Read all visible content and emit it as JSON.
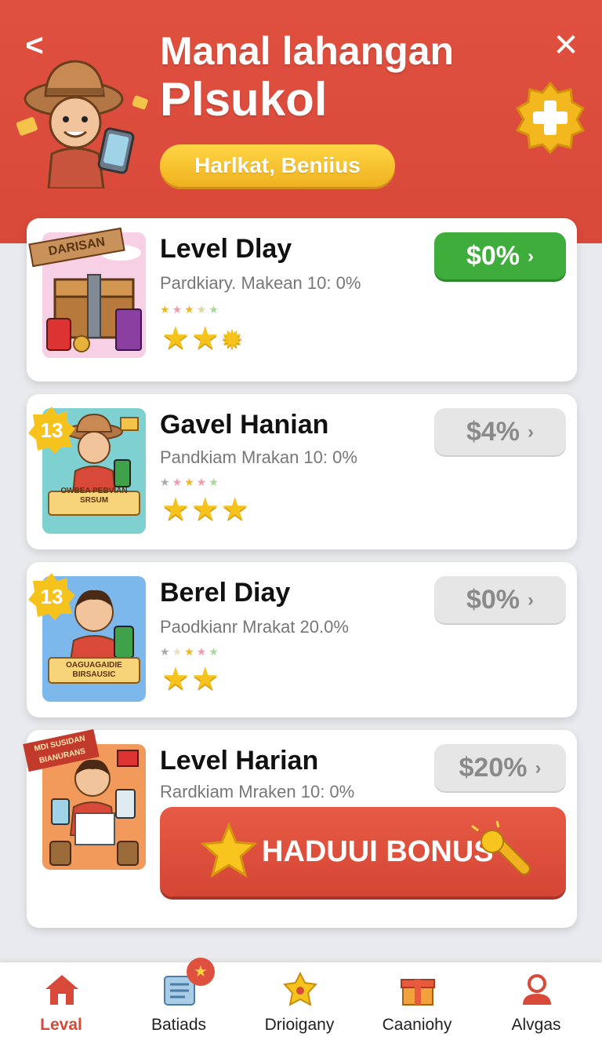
{
  "header": {
    "title_line1": "Manal lahangan",
    "title_line2": "Plsukol",
    "subtitle": "Harlkat, Beniius",
    "back_glyph": "<",
    "close_glyph": "✕",
    "colors": {
      "header_bg": "#d9493a",
      "pill": "#f0b21e"
    }
  },
  "cards": [
    {
      "title": "Level Dlay",
      "subtitle": "Pardkiary. Makean 10: 0%",
      "thumb_label": "DARISAN",
      "value_label": "$0%",
      "value_style": "green",
      "rating_stars": 3
    },
    {
      "title": "Gavel Hanian",
      "subtitle": "Pandkiam Mrakan 10: 0%",
      "thumb_label": "OWBEA PEBVIAN SRSUM",
      "thumb_badge": "13",
      "value_label": "$4%",
      "value_style": "gray",
      "rating_stars": 3
    },
    {
      "title": "Berel Diay",
      "subtitle": "Paodkianr Mrakat 20.0%",
      "thumb_label": "OAGUAGAIDIE BIRSAUSIC",
      "thumb_badge": "13",
      "value_label": "$0%",
      "value_style": "gray",
      "rating_stars": 2
    },
    {
      "title": "Level Harian",
      "subtitle": "Rardkiam Mraken 10: 0%",
      "thumb_label": "MDI SUSIDAN BIANURANS",
      "value_label": "$20%",
      "value_style": "gray",
      "bonus_label": "HADUUI BONUS"
    }
  ],
  "nav": [
    {
      "label": "Leval",
      "icon": "home-icon",
      "active": true
    },
    {
      "label": "Batiads",
      "icon": "document-icon",
      "badge": "★"
    },
    {
      "label": "Drioigany",
      "icon": "star-badge-icon"
    },
    {
      "label": "Caaniohy",
      "icon": "gift-box-icon"
    },
    {
      "label": "Alvgas",
      "icon": "user-icon"
    }
  ],
  "icons": {
    "back": "chevron-left-icon",
    "close": "close-icon",
    "plus": "plus-badge-icon",
    "chevron": "chevron-right-icon"
  },
  "chev_glyph": "›"
}
